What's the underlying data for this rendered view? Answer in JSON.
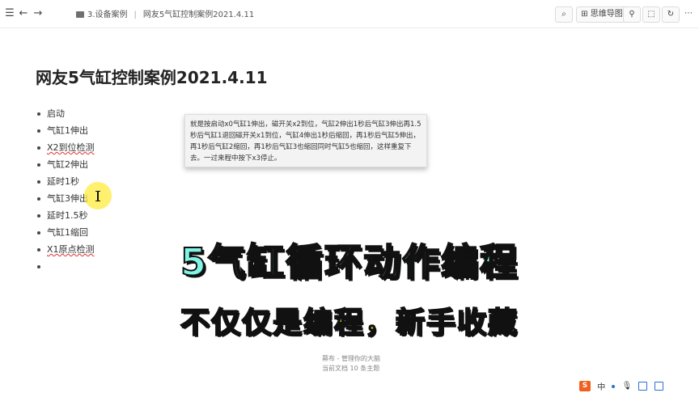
{
  "toolbar": {
    "breadcrumb_folder": "3.设备案例",
    "breadcrumb_doc": "网友5气缸控制案例2021.4.11",
    "mindmap_label": "思维导图"
  },
  "document": {
    "title": "网友5气缸控制案例2021.4.11",
    "items": [
      {
        "label": "启动"
      },
      {
        "label": "气缸1伸出"
      },
      {
        "label": "X2到位检测"
      },
      {
        "label": "气缸2伸出"
      },
      {
        "label": "延时1秒"
      },
      {
        "label": "气缸3伸出"
      },
      {
        "label": "延时1.5秒"
      },
      {
        "label": "气缸1缩回"
      },
      {
        "label": "X1原点检测"
      },
      {
        "label": ""
      }
    ],
    "note": "就是按启动x0气缸1伸出，磁开关x2到位，气缸2伸出1秒后气缸3伸出再1.5秒后气缸1退回磁开关x1到位，气缸4伸出1秒后缩回，再1秒后气缸5伸出，再1秒后气缸2缩回，再1秒后气缸3也缩回同时气缸5也缩回，这样重复下去。一过来程中按下x3停止。"
  },
  "overlay": {
    "headline": "5气缸循环动作编程",
    "subline": "不仅仅是编程，新手收藏"
  },
  "footer": {
    "line1": "幕布 - 管理你的大脑",
    "line2": "当前文档 10 条主题"
  },
  "tray": {
    "ime_label": "中"
  }
}
